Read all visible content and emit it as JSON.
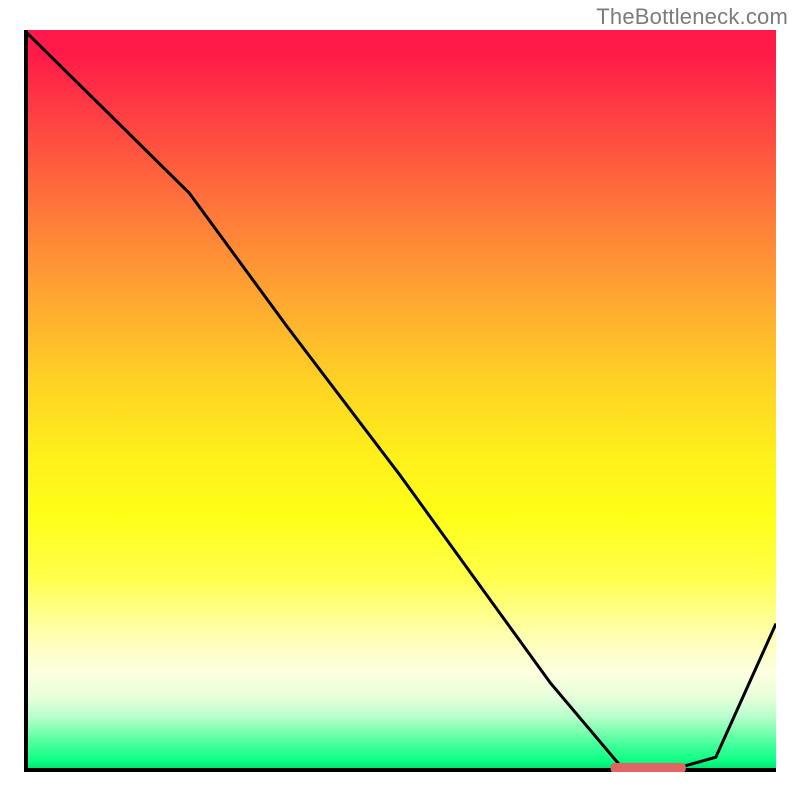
{
  "attribution": "TheBottleneck.com",
  "colors": {
    "curve": "#000000",
    "marker": "#e06666",
    "axis": "#000000"
  },
  "chart_data": {
    "type": "line",
    "title": "",
    "xlabel": "",
    "ylabel": "",
    "xlim": [
      0,
      100
    ],
    "ylim": [
      0,
      100
    ],
    "x": [
      0,
      10,
      22,
      35,
      50,
      60,
      70,
      80,
      85,
      92,
      100
    ],
    "values": [
      100,
      90,
      78,
      60,
      40,
      26,
      12,
      0,
      0,
      2,
      20
    ],
    "marker": {
      "x_start": 78,
      "x_end": 88,
      "y": 0
    },
    "notes": "Curve plunges from top-left, flattens at bottom around x≈80–88, then rises toward the right edge. Background is a vertical red→yellow→green gradient. Values are estimated; no axis tick labels are visible."
  }
}
